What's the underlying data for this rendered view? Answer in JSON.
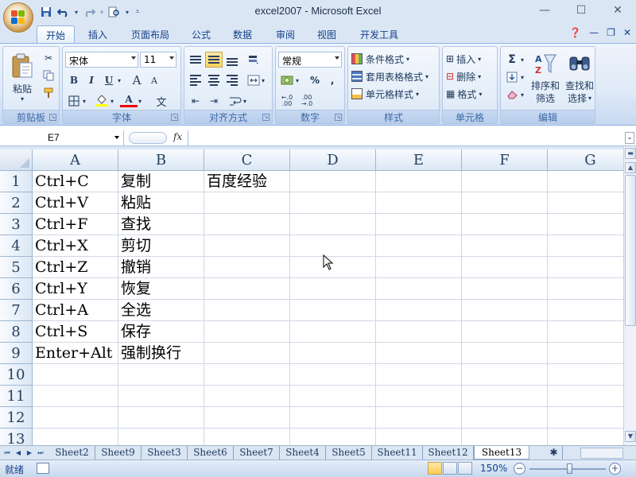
{
  "window": {
    "title": "excel2007 - Microsoft Excel",
    "controls": [
      "minimize-icon",
      "maximize-icon",
      "close-icon"
    ]
  },
  "quick_access": [
    "save-icon",
    "undo-icon",
    "redo-icon",
    "print-preview-icon",
    "customize-icon"
  ],
  "tabs": [
    {
      "label": "开始",
      "active": true
    },
    {
      "label": "插入"
    },
    {
      "label": "页面布局"
    },
    {
      "label": "公式"
    },
    {
      "label": "数据"
    },
    {
      "label": "审阅"
    },
    {
      "label": "视图"
    },
    {
      "label": "开发工具"
    }
  ],
  "ribbon": {
    "clipboard": {
      "paste": "粘贴",
      "label": "剪贴板"
    },
    "font": {
      "name": "宋体",
      "size": "11",
      "label": "字体",
      "bold": "B",
      "italic": "I",
      "underline": "U",
      "grow": "A",
      "shrink": "A",
      "font_color": "A",
      "phonetic": "文"
    },
    "alignment": {
      "label": "对齐方式"
    },
    "number": {
      "format": "常规",
      "label": "数字",
      "percent": "%",
      "comma": ",",
      "inc_decimal": ".0\n.00",
      "dec_decimal": ".00\n.0"
    },
    "styles": {
      "label": "样式",
      "conditional": "条件格式",
      "table": "套用表格格式",
      "cell": "单元格样式"
    },
    "cells": {
      "label": "单元格",
      "insert": "插入",
      "delete": "删除",
      "format": "格式"
    },
    "editing": {
      "label": "编辑",
      "sort": "排序和\n筛选",
      "sort_a": "排序和",
      "sort_b": "筛选",
      "find_a": "查找和",
      "find_b": "选择",
      "sum": "Σ"
    }
  },
  "formula_bar": {
    "name_box": "E7",
    "fx": "fx",
    "content": ""
  },
  "columns": [
    "A",
    "B",
    "C",
    "D",
    "E",
    "F",
    "G"
  ],
  "rows": [
    "1",
    "2",
    "3",
    "4",
    "5",
    "6",
    "7",
    "8",
    "9",
    "10",
    "11",
    "12",
    "13"
  ],
  "cells": [
    [
      "Ctrl+C",
      "复制",
      "百度经验"
    ],
    [
      "Ctrl+V",
      "粘贴",
      ""
    ],
    [
      "Ctrl+F",
      "查找",
      ""
    ],
    [
      "Ctrl+X",
      "剪切",
      ""
    ],
    [
      "Ctrl+Z",
      "撤销",
      ""
    ],
    [
      "Ctrl+Y",
      "恢复",
      ""
    ],
    [
      "Ctrl+A",
      "全选",
      ""
    ],
    [
      "Ctrl+S",
      "保存",
      ""
    ],
    [
      "Enter+Alt",
      "强制换行",
      ""
    ]
  ],
  "sheets": [
    "Sheet2",
    "Sheet9",
    "Sheet3",
    "Sheet6",
    "Sheet7",
    "Sheet4",
    "Sheet5",
    "Sheet11",
    "Sheet12",
    "Sheet13"
  ],
  "active_sheet": "Sheet13",
  "status": {
    "ready": "就绪",
    "zoom": "150%",
    "zoom_level_percent": 150
  }
}
